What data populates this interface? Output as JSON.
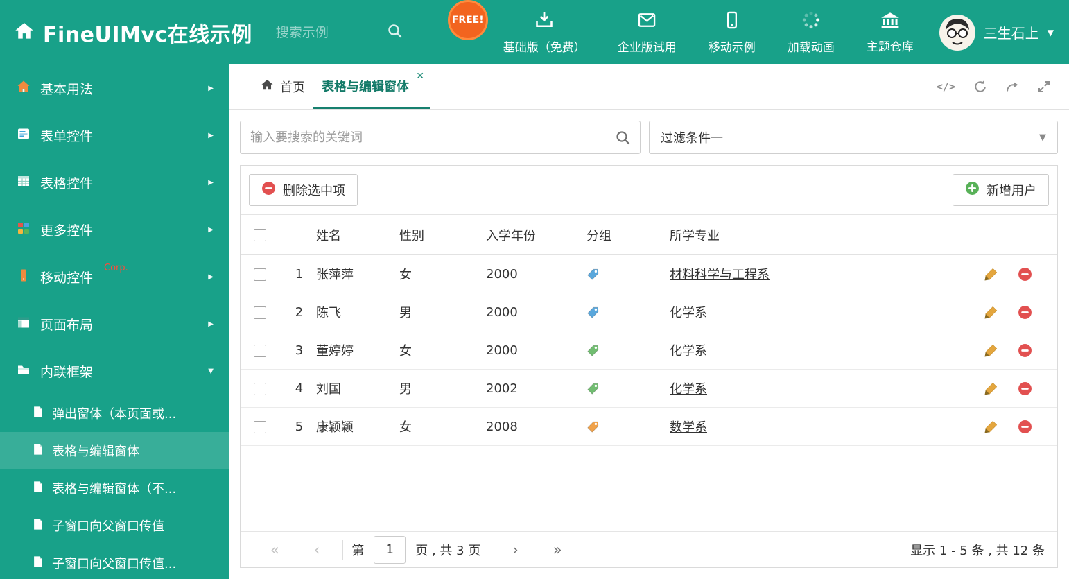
{
  "theme": {
    "teal": "#18a189",
    "teal_dark": "#17806f",
    "danger_red": "#e25050",
    "success_green": "#58b158",
    "pencil_orange": "#e4a63e"
  },
  "header": {
    "title": "FineUIMvc在线示例",
    "search_placeholder": "搜索示例",
    "free_badge": "FREE!",
    "nav": [
      {
        "label": "基础版（免费）"
      },
      {
        "label": "企业版试用"
      },
      {
        "label": "移动示例"
      },
      {
        "label": "加载动画"
      },
      {
        "label": "主题仓库"
      }
    ],
    "user_name": "三生石上"
  },
  "sidebar": {
    "items": [
      {
        "label": "基本用法"
      },
      {
        "label": "表单控件"
      },
      {
        "label": "表格控件"
      },
      {
        "label": "更多控件"
      },
      {
        "label": "移动控件",
        "badge": "Corp."
      },
      {
        "label": "页面布局"
      },
      {
        "label": "内联框架"
      }
    ],
    "subitems": [
      {
        "label": "弹出窗体（本页面或..."
      },
      {
        "label": "表格与编辑窗体"
      },
      {
        "label": "表格与编辑窗体（不..."
      },
      {
        "label": "子窗口向父窗口传值"
      },
      {
        "label": "子窗口向父窗口传值..."
      }
    ]
  },
  "tabs": {
    "home_label": "首页",
    "active_label": "表格与编辑窗体"
  },
  "filter": {
    "search_placeholder": "输入要搜索的关键词",
    "selected_filter": "过滤条件一"
  },
  "toolbar": {
    "delete_label": "删除选中项",
    "add_label": "新增用户"
  },
  "table": {
    "columns": {
      "name": "姓名",
      "gender": "性别",
      "year": "入学年份",
      "group": "分组",
      "major": "所学专业"
    },
    "rows": [
      {
        "index": "1",
        "name": "张萍萍",
        "gender": "女",
        "year": "2000",
        "tag_color": "#5aa7dc",
        "major": "材料科学与工程系"
      },
      {
        "index": "2",
        "name": "陈飞",
        "gender": "男",
        "year": "2000",
        "tag_color": "#5aa7dc",
        "major": "化学系"
      },
      {
        "index": "3",
        "name": "董婷婷",
        "gender": "女",
        "year": "2000",
        "tag_color": "#71bd71",
        "major": "化学系"
      },
      {
        "index": "4",
        "name": "刘国",
        "gender": "男",
        "year": "2002",
        "tag_color": "#71bd71",
        "major": "化学系"
      },
      {
        "index": "5",
        "name": "康颖颖",
        "gender": "女",
        "year": "2008",
        "tag_color": "#f0a24a",
        "major": "数学系"
      }
    ]
  },
  "pagination": {
    "page_prefix": "第",
    "current_page": "1",
    "page_suffix": "页 , 共 3 页",
    "summary": "显示 1 - 5 条 , 共 12 条"
  }
}
